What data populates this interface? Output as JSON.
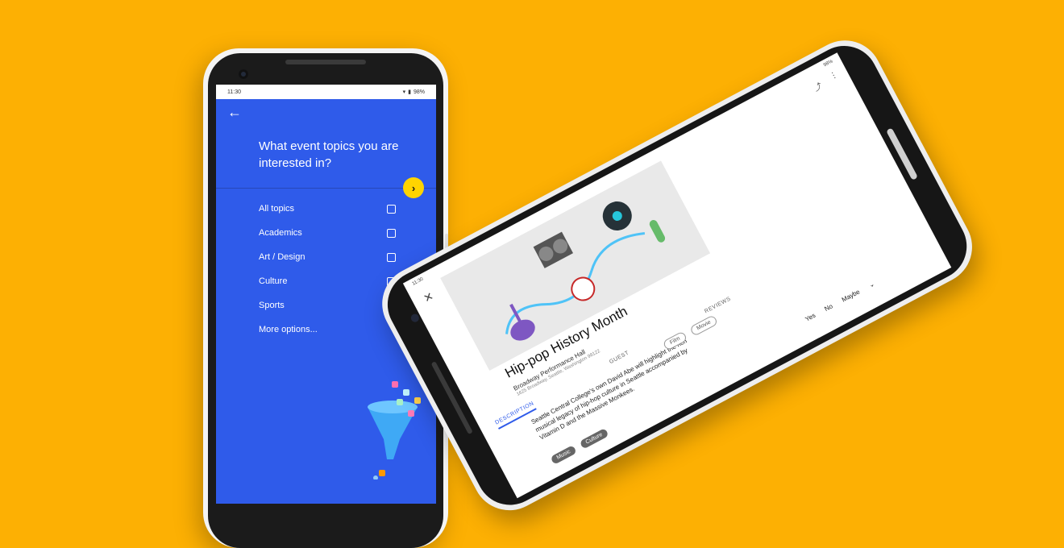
{
  "colors": {
    "background": "#FDB003",
    "primary_blue": "#2F5BEA",
    "fab_yellow": "#FFD400"
  },
  "phone1": {
    "status_bar": {
      "time": "11:30",
      "battery": "98%"
    },
    "icons": {
      "back": "back-arrow-icon",
      "next": "chevron-right-icon",
      "wifi": "wifi-icon",
      "battery": "battery-icon"
    },
    "question": "What event topics you are interested in?",
    "topics": [
      {
        "label": "All topics",
        "checkbox": true,
        "checked": false
      },
      {
        "label": "Academics",
        "checkbox": true,
        "checked": false
      },
      {
        "label": "Art / Design",
        "checkbox": true,
        "checked": false
      },
      {
        "label": "Culture",
        "checkbox": true,
        "checked": false
      },
      {
        "label": "Sports",
        "checkbox": false
      },
      {
        "label": "More options...",
        "checkbox": false
      }
    ]
  },
  "phone2": {
    "status_bar": {
      "time": "11:30",
      "battery": "98%"
    },
    "icons": {
      "close": "close-icon",
      "share": "share-icon",
      "more": "more-vert-icon",
      "location": "location-pin-icon",
      "description": "description-icon",
      "expand": "chevron-down-icon"
    },
    "event": {
      "title": "Hip-pop History Month",
      "venue": "Broadway Performance Hall",
      "address": "1625 Broadway, Seattle, Washington 98122"
    },
    "tabs": [
      "DESCRIPTION",
      "GUEST",
      "REVIEWS"
    ],
    "active_tab": "DESCRIPTION",
    "description": "Seattle Central College's own David Abe will highlight the rich musical legacy of hip-hop culture in Seattle accompanied by Vitamin D and the Massive Monkees.",
    "tags_dark": [
      "Music",
      "Culture"
    ],
    "tags_light": [
      "Film",
      "Movie"
    ],
    "rsvp": [
      "Yes",
      "No",
      "Maybe"
    ]
  }
}
